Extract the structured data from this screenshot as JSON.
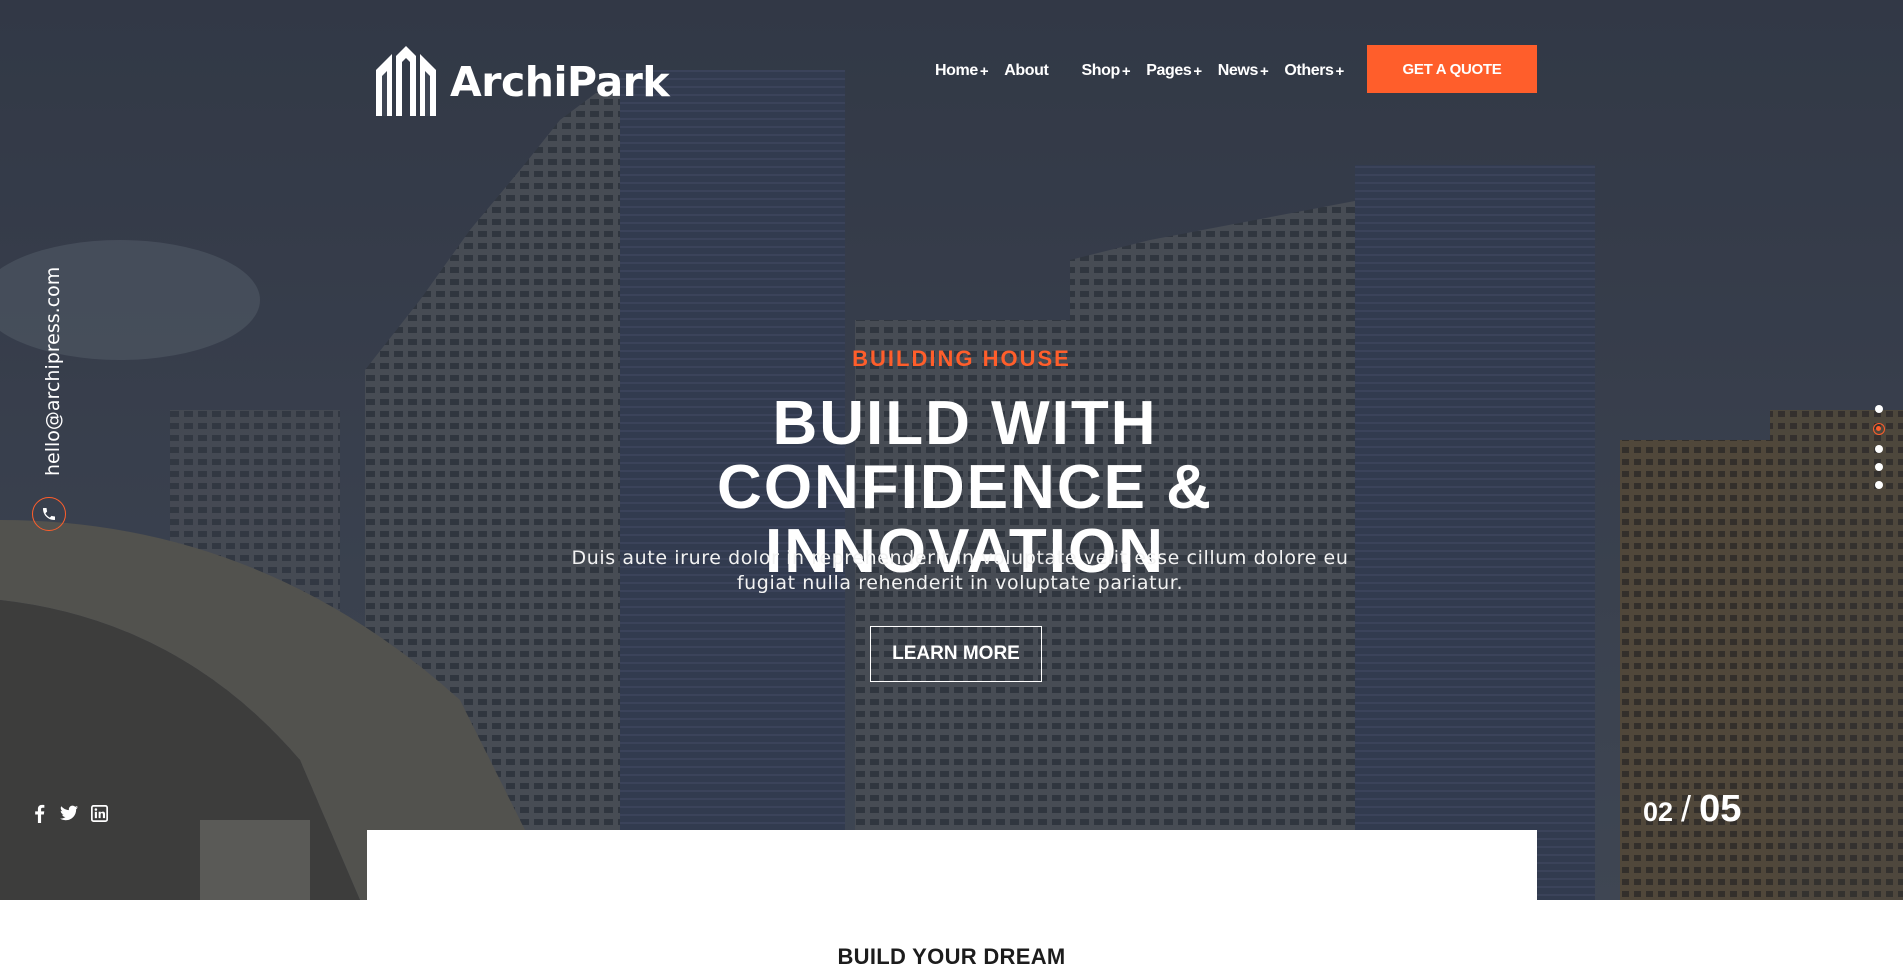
{
  "brand": {
    "name": "ArchiPark",
    "logo_icon": "building-logo-icon"
  },
  "nav": {
    "items": [
      {
        "label": "Home",
        "has_submenu": true
      },
      {
        "label": "About",
        "has_submenu": false
      },
      {
        "label": "Shop",
        "has_submenu": true
      },
      {
        "label": "Pages",
        "has_submenu": true
      },
      {
        "label": "News",
        "has_submenu": true
      },
      {
        "label": "Others",
        "has_submenu": true
      }
    ],
    "submenu_indicator": "+",
    "cta": "GET A QUOTE"
  },
  "hero": {
    "subtitle": "BUILDING HOUSE",
    "headline": "BUILD WITH CONFIDENCE & INNOVATION",
    "description": "Duis aute irure dolor in reprehenderit in voluptate velit esse cillum dolore eu fugiat nulla rehenderit in voluptate pariatur.",
    "button": "LEARN MORE"
  },
  "contact": {
    "email": "hello@archipress.com",
    "phone_icon": "phone-icon"
  },
  "social": [
    "facebook-icon",
    "twitter-icon",
    "linkedin-icon"
  ],
  "slider": {
    "current": "02",
    "separator": "/",
    "total": "05",
    "dot_count": 5,
    "active_index": 1
  },
  "section": {
    "title": "BUILD YOUR DREAM"
  },
  "colors": {
    "accent": "#ff5e2b",
    "overlay": "#3f4654",
    "text": "#ffffff"
  }
}
